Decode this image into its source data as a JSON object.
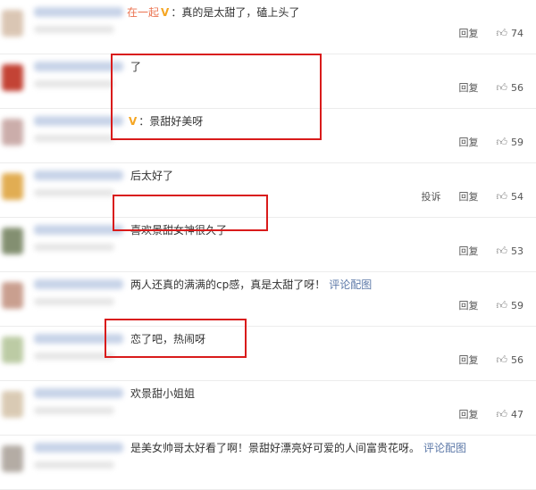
{
  "labels": {
    "reply": "回复",
    "report": "投诉"
  },
  "colors": {
    "highlight_box": "#d91b1b",
    "link": "#eb7350",
    "detail_link": "#5d79a8"
  },
  "comments": [
    {
      "link_part": "在一起",
      "verified": "V",
      "text": "：真的是太甜了，磕上头了",
      "likes": "74",
      "report": false
    },
    {
      "link_part": "",
      "verified": "",
      "text": "了",
      "likes": "56",
      "report": false
    },
    {
      "link_part": "",
      "verified": "V",
      "text": "：景甜好美呀",
      "likes": "59",
      "report": false
    },
    {
      "link_part": "",
      "verified": "",
      "text": "后太好了",
      "likes": "54",
      "report": true
    },
    {
      "link_part": "",
      "verified": "",
      "text": "喜欢景甜女神很久了",
      "likes": "53",
      "report": false
    },
    {
      "link_part": "",
      "verified": "",
      "text": "两人还真的满满的cp感，真是太甜了呀！",
      "detail": "评论配图",
      "likes": "59",
      "report": false
    },
    {
      "link_part": "",
      "verified": "",
      "text": "恋了吧，热闹呀",
      "likes": "56",
      "report": false
    },
    {
      "link_part": "",
      "verified": "",
      "text": "欢景甜小姐姐",
      "likes": "47",
      "report": false
    },
    {
      "link_part": "",
      "verified": "",
      "text": "是美女帅哥太好看了啊！景甜好漂亮好可爱的人间富贵花呀。",
      "detail": "评论配图",
      "likes": "",
      "report": false
    }
  ]
}
